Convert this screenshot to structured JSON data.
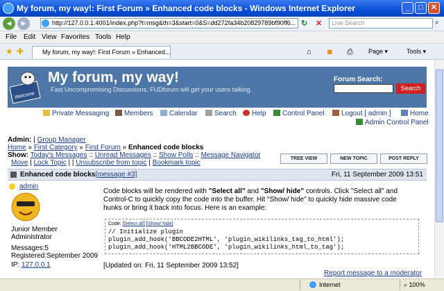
{
  "window": {
    "title": "My forum, my way!: First Forum » Enhanced code blocks - Windows Internet Explorer",
    "minimize": "_",
    "maximize": "□",
    "close": "✕"
  },
  "browser": {
    "address": "http://127.0.0.1:4001/index.php?t=msg&th=3&start=0&S=dd272fa34b20829789bf90ff6...",
    "search_placeholder": "Live Search",
    "back": "◄",
    "forward": "►",
    "refresh": "↻",
    "stop": "✕",
    "go": "→",
    "menu": [
      "File",
      "Edit",
      "View",
      "Favorites",
      "Tools",
      "Help"
    ],
    "tab_title": "My forum, my way!: First Forum » Enhanced...",
    "page_cmd": "Page ▾",
    "tools_cmd": "Tools ▾"
  },
  "forum": {
    "title": "My forum, my way!",
    "tagline": "Fast Uncompromising Discussions. FUDforum will get your users talking.",
    "logo_text": "Welcome",
    "search_label": "Forum Search:",
    "search_button": "Search",
    "nav": {
      "private_messaging": "Private Messaging",
      "members": "Members",
      "calendar": "Calendar",
      "search": "Search",
      "help": "Help",
      "control_panel": "Control Panel",
      "logout": "Logout [ admin ]",
      "home": "Home",
      "admin_cp": "Admin Control Panel"
    },
    "admin_line": {
      "label": "Admin:",
      "sep": "|",
      "group_manager": "Group Manager"
    },
    "breadcrumb": {
      "home": "Home",
      "sep": "»",
      "category": "First Category",
      "forum": "First Forum",
      "topic": "Enhanced code blocks"
    },
    "show_line": {
      "label": "Show:",
      "todays": "Today's Messages",
      "unread": "Unread Messages",
      "polls": "Show Polls",
      "navigator": "Message Navigator",
      "sep": "::"
    },
    "actions_line": {
      "move": "Move",
      "lock": "Lock Topic",
      "sep": "|",
      "unsubscribe": "Unsubscribe from topic",
      "bookmark": "Bookmark topic"
    },
    "buttons": {
      "tree_view": "TREE VIEW",
      "new_topic": "NEW TOPIC",
      "post_reply": "POST REPLY"
    },
    "topic": {
      "title": "Enhanced code blocks",
      "message_ref": "[message #3]",
      "date": "Fri, 11 September 2009 13:51"
    },
    "author": {
      "name": "admin",
      "rank": "Junior Member",
      "role": "Administrator",
      "messages": "Messages:5",
      "registered": "Registered:September 2009",
      "ip_label": "IP:",
      "ip": "127.0.0.1"
    },
    "post": {
      "p1": "Code blocks will be rendered with ",
      "b1": "\"Select all\"",
      "p2": " and ",
      "b2": "\"Show/ hide\"",
      "p3": " controls. Click \"Select all\" and",
      "line2": "Control-C to quickly copy the code into the buffer. Hit \"Show/ hide\" to quickly hide massive code",
      "line3": "hunks or bring it back into focus. Here is an example:",
      "code_label": "Code:",
      "code_select": "[Select all]",
      "code_toggle": "[Show/ hide]",
      "code_lines": [
        "// Initialize plugin",
        "plugin_add_hook('BBCODE2HTML', 'plugin_wikilinks_tag_to_html');",
        "plugin_add_hook('HTML2BBCODE', 'plugin_wikilinks_html_to_tag');"
      ],
      "updated": "[Updated on: Fri, 11 September 2009 13:52]",
      "report": "Report message to a moderator"
    }
  },
  "statusbar": {
    "zone": "Internet",
    "zoom": "100%"
  },
  "colors": {
    "header_bg": "#4e76a6",
    "link": "#1a3d8f",
    "search_button": "#d02020",
    "titlebar": "#0a4fd6"
  }
}
